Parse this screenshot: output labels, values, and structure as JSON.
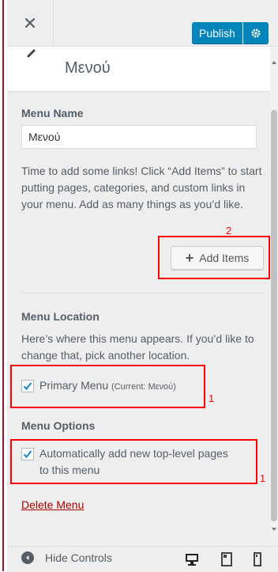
{
  "header": {
    "close_label": "Close",
    "publish_label": "Publish"
  },
  "section": {
    "title": "Μενού"
  },
  "menu_name": {
    "label": "Menu Name",
    "value": "Μενού"
  },
  "help_text": "Time to add some links! Click “Add Items” to start putting pages, categories, and custom links in your menu. Add as many things as you’d like.",
  "add_items": {
    "label": "Add Items",
    "annotation": "2"
  },
  "menu_location": {
    "label": "Menu Location",
    "description": "Here’s where this menu appears. If you’d like to change that, pick another location.",
    "primary_label": "Primary Menu",
    "primary_current": "(Current: Μενού)",
    "checked": true,
    "annotation": "1"
  },
  "menu_options": {
    "label": "Menu Options",
    "auto_add_line1": "Automatically add new top-level pages",
    "auto_add_line2": "to this menu",
    "checked": true,
    "annotation": "1"
  },
  "delete_label": "Delete Menu",
  "footer": {
    "hide_controls": "Hide Controls"
  },
  "colors": {
    "accent": "#0085ba",
    "annotation": "#ff0000",
    "delete_link": "#a00000"
  }
}
